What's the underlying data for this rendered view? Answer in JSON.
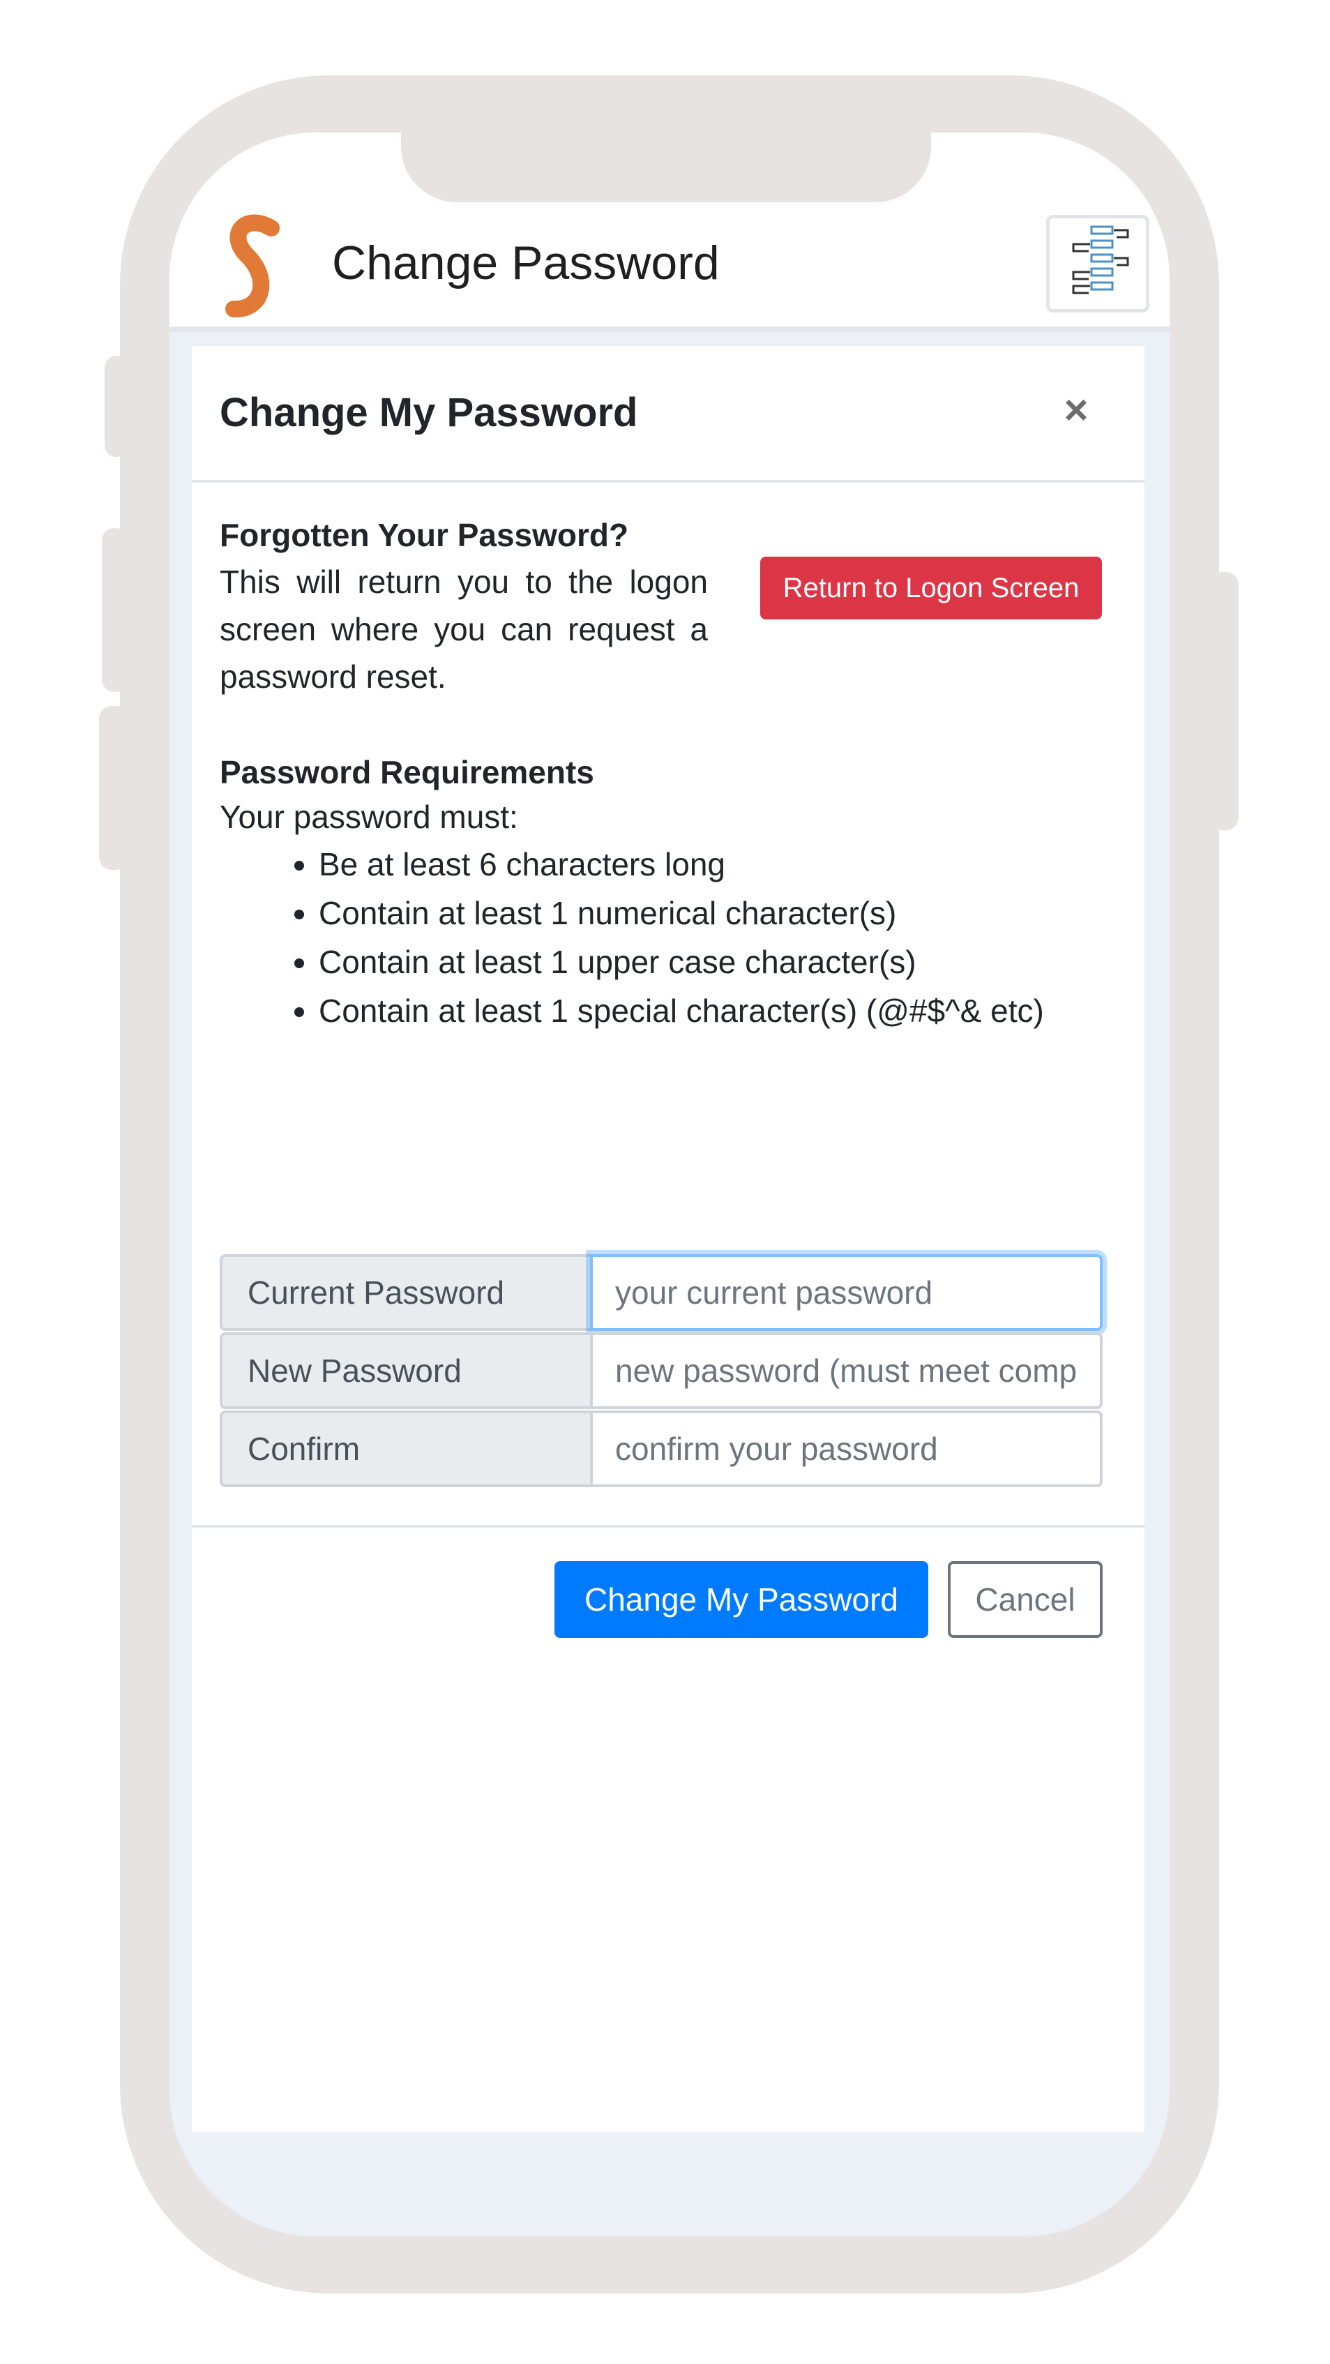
{
  "app": {
    "title": "Change Password",
    "logo_icon": "app-logo-icon",
    "flow_icon": "workflow-icon"
  },
  "modal": {
    "title": "Change My Password",
    "close_label": "×",
    "forgot": {
      "heading": "Forgotten Your Password?",
      "text": "This will return you to the logon screen where you can request a password reset.",
      "button_label": "Return to Logon Screen"
    },
    "requirements": {
      "heading": "Password Requirements",
      "intro": "Your password must:",
      "items": [
        "Be at least 6 characters long",
        "Contain at least 1 numerical character(s)",
        "Contain at least 1 upper case character(s)",
        "Contain at least 1 special character(s) (@#$^& etc)"
      ]
    },
    "form": {
      "current": {
        "label": "Current Password",
        "placeholder": "your current password",
        "value": ""
      },
      "new": {
        "label": "New Password",
        "placeholder": "new password (must meet complexity requirements)",
        "value": ""
      },
      "confirm": {
        "label": "Confirm",
        "placeholder": "confirm your password",
        "value": ""
      }
    },
    "footer": {
      "submit_label": "Change My Password",
      "cancel_label": "Cancel"
    }
  },
  "colors": {
    "primary": "#007bff",
    "danger": "#dc3545",
    "logo": "#e07a36",
    "frame": "#e8e3e3"
  }
}
